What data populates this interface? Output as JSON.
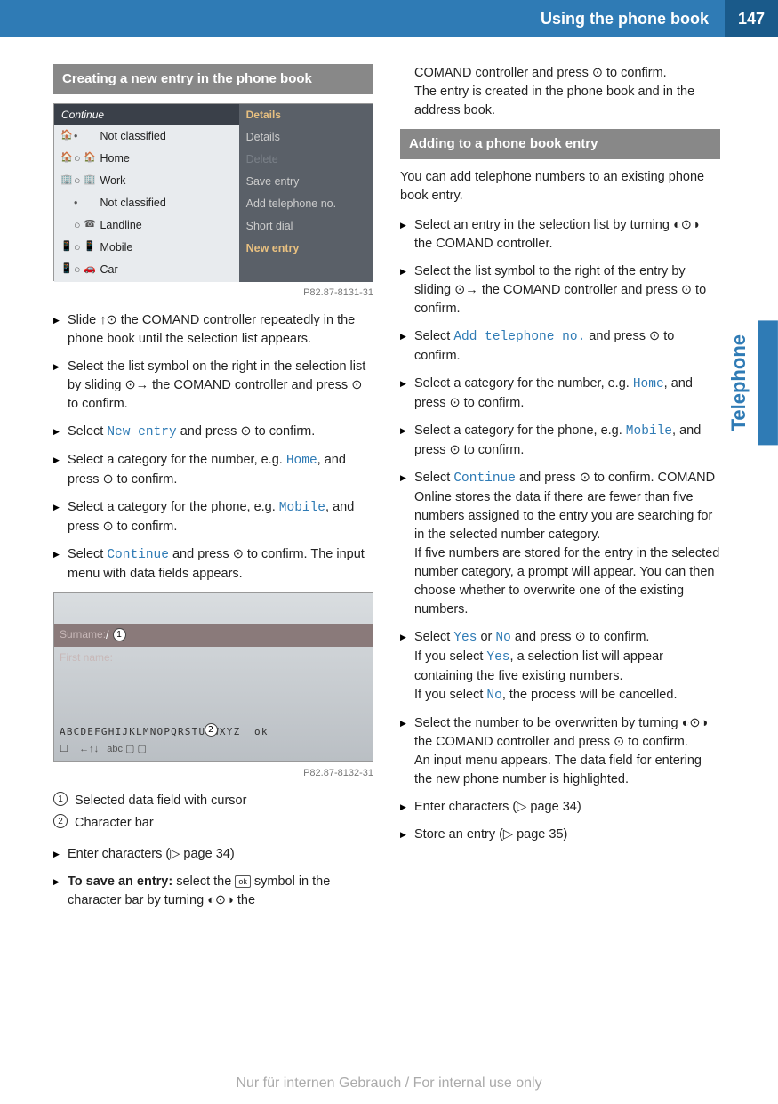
{
  "header": {
    "title": "Using the phone book",
    "page": "147"
  },
  "sidetab": "Telephone",
  "left": {
    "section1_title": "Creating a new entry in the phone book",
    "ss1": {
      "top_left": "Continue",
      "top_right": "Details",
      "lrows": [
        {
          "i1": "🏠",
          "d": "•",
          "t": "Not classified"
        },
        {
          "i1": "🏠",
          "d": "○",
          "i2": "🏠",
          "t": "Home"
        },
        {
          "i1": "🏢",
          "d": "○",
          "i2": "🏢",
          "t": "Work"
        },
        {
          "i1": "",
          "d": "•",
          "t": "Not classified"
        },
        {
          "i1": "",
          "d": "○",
          "i2": "☎",
          "t": "Landline"
        },
        {
          "i1": "📱",
          "d": "○",
          "i2": "📱",
          "t": "Mobile"
        },
        {
          "i1": "📱",
          "d": "○",
          "i2": "🚗",
          "t": "Car"
        }
      ],
      "rrows": [
        "Details",
        "Delete",
        "Save entry",
        "Add telephone no.",
        "Short dial",
        "New entry"
      ],
      "figid": "P82.87-8131-31"
    },
    "steps1": [
      {
        "html": "Slide <span class='glyph'>↑⊙</span> the COMAND controller repeatedly in the phone book until the selection list appears."
      },
      {
        "html": "Select the list symbol on the right in the selection list by sliding <span class='glyph'>⊙→</span> the COMAND controller and press <span class='glyph'>⊙</span> to confirm."
      },
      {
        "html": "Select <span class='code'>New entry</span> and press <span class='glyph'>⊙</span> to confirm."
      },
      {
        "html": "Select a category for the number, e.g. <span class='code'>Home</span>, and press <span class='glyph'>⊙</span> to confirm."
      },
      {
        "html": "Select a category for the phone, e.g. <span class='code'>Mobile</span>, and press <span class='glyph'>⊙</span> to confirm."
      },
      {
        "html": "Select <span class='code'>Continue</span> and press <span class='glyph'>⊙</span> to confirm. The input menu with data fields appears."
      }
    ],
    "ss2": {
      "surname_label": "Surname:",
      "firstname_label": "First name:",
      "charbar": "ABCDEFGHIJKLMNOPQRSTUVWXYZ_ ok",
      "figid": "P82.87-8132-31"
    },
    "legend": [
      {
        "n": "1",
        "t": "Selected data field with cursor"
      },
      {
        "n": "2",
        "t": "Character bar"
      }
    ],
    "steps2": [
      {
        "html": "Enter characters (▷ page 34)"
      },
      {
        "html": "<b>To save an entry:</b> select the <span class='ok-sym'>ok</span> symbol in the character bar by turning <span class='glyph'>◐⊙◑</span> the"
      }
    ]
  },
  "right": {
    "cont1": "COMAND controller and press <span class='glyph'>⊙</span> to confirm.",
    "cont2": "The entry is created in the phone book and in the address book.",
    "section2_title": "Adding to a phone book entry",
    "intro2": "You can add telephone numbers to an existing phone book entry.",
    "steps3": [
      {
        "html": "Select an entry in the selection list by turning <span class='glyph'>◐⊙◑</span> the COMAND controller."
      },
      {
        "html": "Select the list symbol to the right of the entry by sliding <span class='glyph'>⊙→</span> the COMAND controller and press <span class='glyph'>⊙</span> to confirm."
      },
      {
        "html": "Select <span class='code'>Add telephone no.</span> and press <span class='glyph'>⊙</span> to confirm."
      },
      {
        "html": "Select a category for the number, e.g. <span class='code'>Home</span>, and press <span class='glyph'>⊙</span> to confirm."
      },
      {
        "html": "Select a category for the phone, e.g. <span class='code'>Mobile</span>, and press <span class='glyph'>⊙</span> to confirm."
      },
      {
        "html": "Select <span class='code'>Continue</span> and press <span class='glyph'>⊙</span> to confirm. COMAND Online stores the data if there are fewer than five numbers assigned to the entry you are searching for in the selected number category.<br>If five numbers are stored for the entry in the selected number category, a prompt will appear. You can then choose whether to overwrite one of the existing numbers."
      },
      {
        "html": "Select <span class='code'>Yes</span> or <span class='code'>No</span> and press <span class='glyph'>⊙</span> to confirm.<br>If you select <span class='code'>Yes</span>, a selection list will appear containing the five existing numbers.<br>If you select <span class='code'>No</span>, the process will be cancelled."
      },
      {
        "html": "Select the number to be overwritten by turning <span class='glyph'>◐⊙◑</span> the COMAND controller and press <span class='glyph'>⊙</span> to confirm.<br>An input menu appears. The data field for entering the new phone number is highlighted."
      },
      {
        "html": "Enter characters (▷ page 34)"
      },
      {
        "html": "Store an entry (▷ page 35)"
      }
    ]
  },
  "footer": "Nur für internen Gebrauch / For internal use only"
}
